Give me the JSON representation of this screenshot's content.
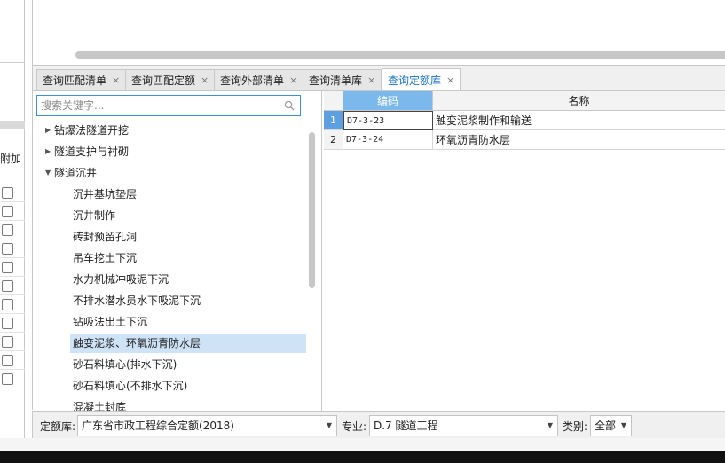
{
  "left_panel": {
    "column_header": "附加",
    "checkbox_rows": [
      false,
      false,
      false,
      false,
      false,
      false,
      false,
      false,
      false,
      false,
      false
    ]
  },
  "tabs": [
    {
      "label": "查询匹配清单",
      "close": "×",
      "active": false
    },
    {
      "label": "查询匹配定额",
      "close": "×",
      "active": false
    },
    {
      "label": "查询外部清单",
      "close": "×",
      "active": false
    },
    {
      "label": "查询清单库",
      "close": "×",
      "active": false
    },
    {
      "label": "查询定额库",
      "close": "×",
      "active": true
    }
  ],
  "search": {
    "placeholder": "搜索关键字...",
    "value": "",
    "icon": "search-icon"
  },
  "tree": {
    "items": [
      {
        "label": "钻爆法隧道开挖",
        "level": 1,
        "expanded": false
      },
      {
        "label": "隧道支护与衬砌",
        "level": 1,
        "expanded": false
      },
      {
        "label": "隧道沉井",
        "level": 1,
        "expanded": true
      },
      {
        "label": "沉井基坑垫层",
        "level": 2
      },
      {
        "label": "沉井制作",
        "level": 2
      },
      {
        "label": "砖封预留孔洞",
        "level": 2
      },
      {
        "label": "吊车挖土下沉",
        "level": 2
      },
      {
        "label": "水力机械冲吸泥下沉",
        "level": 2
      },
      {
        "label": "不排水潜水员水下吸泥下沉",
        "level": 2
      },
      {
        "label": "钻吸法出土下沉",
        "level": 2
      },
      {
        "label": "触变泥浆、环氧沥青防水层",
        "level": 2,
        "selected": true
      },
      {
        "label": "砂石料填心(排水下沉)",
        "level": 2
      },
      {
        "label": "砂石料填心(不排水下沉)",
        "level": 2
      },
      {
        "label": "混凝土封底",
        "level": 2
      }
    ]
  },
  "grid": {
    "headers": {
      "code": "编码",
      "name": "名称"
    },
    "rows": [
      {
        "num": "1",
        "code": "D7-3-23",
        "name": "触变泥浆制作和输送"
      },
      {
        "num": "2",
        "code": "D7-3-24",
        "name": "环氧沥青防水层"
      }
    ]
  },
  "bottom_bar": {
    "library_label": "定额库:",
    "library_value": "广东省市政工程综合定额(2018)",
    "major_label": "专业:",
    "major_value": "D.7 隧道工程",
    "category_label": "类别:",
    "category_value": "全部"
  },
  "colors": {
    "accent": "#1a73c8",
    "header_selected": "#7bb8ec",
    "tree_selected": "#cfe3f7"
  }
}
